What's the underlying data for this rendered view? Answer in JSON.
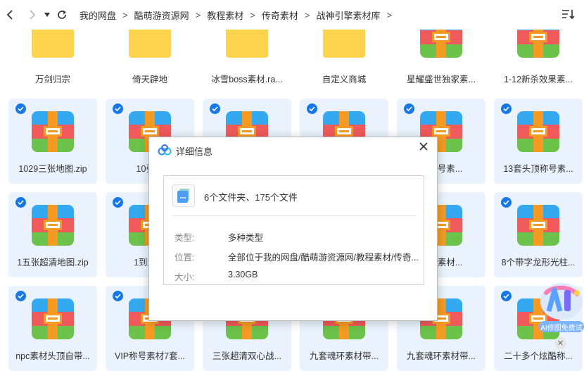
{
  "breadcrumb": [
    "我的网盘",
    "酷萌游资源网",
    "教程素材",
    "传奇素材",
    "战神引擎素材库"
  ],
  "files": [
    {
      "name": "万剑归宗",
      "type": "folder",
      "selected": false
    },
    {
      "name": "倚天辟地",
      "type": "folder",
      "selected": false
    },
    {
      "name": "冰雪boss素材.ra...",
      "type": "folder",
      "selected": false
    },
    {
      "name": "自定义商城",
      "type": "folder",
      "selected": false
    },
    {
      "name": "星耀盛世独家素...",
      "type": "zip",
      "selected": false
    },
    {
      "name": "1-12新杀效果素...",
      "type": "zip",
      "selected": false
    },
    {
      "name": "1029三张地图.zip",
      "type": "zip",
      "selected": true
    },
    {
      "name": "10张地",
      "type": "zip",
      "selected": true
    },
    {
      "name": "",
      "type": "zip",
      "selected": true
    },
    {
      "name": "",
      "type": "zip",
      "selected": true
    },
    {
      "name": "顶称号素...",
      "type": "zip",
      "selected": true
    },
    {
      "name": "13套头顶称号素...",
      "type": "zip",
      "selected": true
    },
    {
      "name": "1五张超清地图.zip",
      "type": "zip",
      "selected": true
    },
    {
      "name": "1到10品",
      "type": "zip",
      "selected": true
    },
    {
      "name": "",
      "type": "zip",
      "selected": true
    },
    {
      "name": "",
      "type": "zip",
      "selected": true
    },
    {
      "name": "地图素材...",
      "type": "zip",
      "selected": true
    },
    {
      "name": "8个带字龙形光柱...",
      "type": "zip",
      "selected": true
    },
    {
      "name": "npc素材头顶自带...",
      "type": "zip",
      "selected": true
    },
    {
      "name": "VIP称号素材7套...",
      "type": "zip",
      "selected": true
    },
    {
      "name": "三张超清双心战...",
      "type": "zip",
      "selected": true
    },
    {
      "name": "九套魂环素材带...",
      "type": "zip",
      "selected": true
    },
    {
      "name": "九套魂环素材带...",
      "type": "zip",
      "selected": true
    },
    {
      "name": "二十多个炫酷称...",
      "type": "zip",
      "selected": true
    }
  ],
  "dialog": {
    "title": "详细信息",
    "summary": "6个文件夹、175个文件",
    "type_label": "类型:",
    "type_value": "多种类型",
    "location_label": "位置:",
    "location_value": "全部位于我的网盘/酷萌游资源网/教程素材/传奇...",
    "size_label": "大小:",
    "size_value": "3.30GB"
  },
  "ai_widget": {
    "label": "AI修图免费试"
  },
  "colors": {
    "accent": "#1677e8",
    "selected_bg": "#eaf3fd"
  }
}
